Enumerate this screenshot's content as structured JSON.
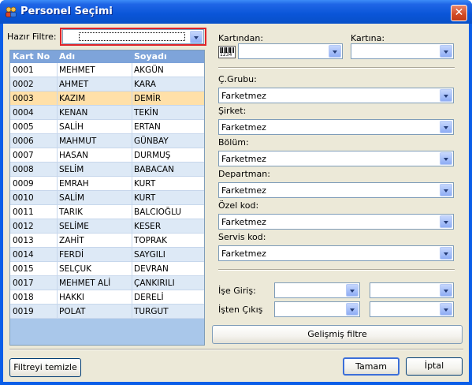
{
  "window": {
    "title": "Personel Seçimi",
    "close_glyph": "✕"
  },
  "filter": {
    "label": "Hazır Filtre:",
    "value": ""
  },
  "grid": {
    "columns": [
      "Kart No",
      "Adı",
      "Soyadı"
    ],
    "selected_index": 2,
    "rows": [
      [
        "0001",
        "MEHMET",
        "AKGÜN"
      ],
      [
        "0002",
        "AHMET",
        "KARA"
      ],
      [
        "0003",
        "KAZIM",
        "DEMİR"
      ],
      [
        "0004",
        "KENAN",
        "TEKİN"
      ],
      [
        "0005",
        "SALİH",
        "ERTAN"
      ],
      [
        "0006",
        "MAHMUT",
        "GÜNBAY"
      ],
      [
        "0007",
        "HASAN",
        "DURMUŞ"
      ],
      [
        "0008",
        "SELİM",
        "BABACAN"
      ],
      [
        "0009",
        "EMRAH",
        "KURT"
      ],
      [
        "0010",
        "SALİM",
        "KURT"
      ],
      [
        "0011",
        "TARIK",
        "BALCIOĞLU"
      ],
      [
        "0012",
        "SELİME",
        "KESER"
      ],
      [
        "0013",
        "ZAHİT",
        "TOPRAK"
      ],
      [
        "0014",
        "FERDİ",
        "SAYGILI"
      ],
      [
        "0015",
        "SELÇUK",
        "DEVRAN"
      ],
      [
        "0017",
        "MEHMET ALİ",
        "ÇANKIRILI"
      ],
      [
        "0018",
        "HAKKI",
        "DERELİ"
      ],
      [
        "0019",
        "POLAT",
        "TURGUT"
      ]
    ]
  },
  "card_range": {
    "from_label": "Kartından:",
    "to_label": "Kartına:",
    "from_value": "",
    "to_value": "",
    "barcode_icon_text": "1234"
  },
  "filters": [
    {
      "label": "Ç.Grubu:",
      "value": "Farketmez"
    },
    {
      "label": "Şirket:",
      "value": "Farketmez"
    },
    {
      "label": "Bölüm:",
      "value": "Farketmez"
    },
    {
      "label": "Departman:",
      "value": "Farketmez"
    },
    {
      "label": "Özel kod:",
      "value": "Farketmez"
    },
    {
      "label": "Servis kod:",
      "value": "Farketmez"
    }
  ],
  "dates": {
    "hire_label": "İşe Giriş:",
    "exit_label": "İşten Çıkış",
    "hire_from": "",
    "hire_to": "",
    "exit_from": "",
    "exit_to": ""
  },
  "buttons": {
    "advanced_filter": "Gelişmiş filtre",
    "clear_filter": "Filtreyi temizle",
    "ok": "Tamam",
    "cancel": "İptal"
  }
}
